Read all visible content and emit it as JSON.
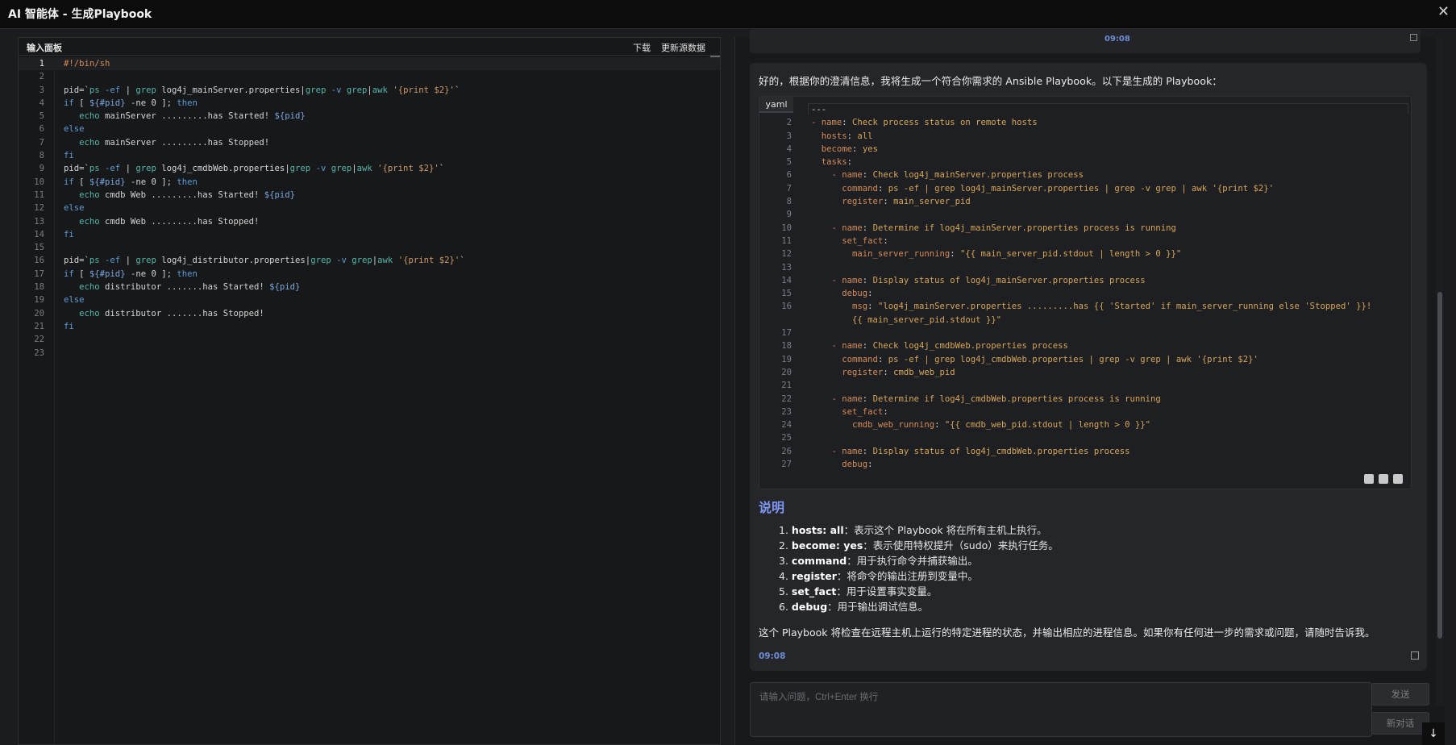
{
  "window": {
    "title": "AI 智能体 - 生成Playbook",
    "close": "✕"
  },
  "left_panel": {
    "title": "输入面板",
    "download": "下载",
    "update_source": "更新源数据",
    "lines": [
      {
        "n": "1",
        "t": [
          [
            "cm",
            "#!/bin/sh"
          ]
        ]
      },
      {
        "n": "2",
        "t": []
      },
      {
        "n": "3",
        "t": [
          [
            "tx",
            "pid=`"
          ],
          [
            "fn",
            "ps"
          ],
          [
            "tx",
            " "
          ],
          [
            "kw",
            "-ef"
          ],
          [
            "tx",
            " | "
          ],
          [
            "fn",
            "grep"
          ],
          [
            "tx",
            " log4j_mainServer.properties|"
          ],
          [
            "fn",
            "grep"
          ],
          [
            "tx",
            " "
          ],
          [
            "kw",
            "-v"
          ],
          [
            "tx",
            " "
          ],
          [
            "fn",
            "grep"
          ],
          [
            "tx",
            "|"
          ],
          [
            "fn",
            "awk"
          ],
          [
            "tx",
            " "
          ],
          [
            "st",
            "'{print $2}'"
          ],
          [
            "tx",
            "`"
          ]
        ]
      },
      {
        "n": "4",
        "t": [
          [
            "kw",
            "if"
          ],
          [
            "tx",
            " [ "
          ],
          [
            "vr",
            "${#pid}"
          ],
          [
            "tx",
            " -ne 0 ]; "
          ],
          [
            "kw",
            "then"
          ]
        ]
      },
      {
        "n": "5",
        "t": [
          [
            "tx",
            "   "
          ],
          [
            "fn",
            "echo"
          ],
          [
            "tx",
            " mainServer .........has Started! "
          ],
          [
            "vr",
            "${pid}"
          ]
        ]
      },
      {
        "n": "6",
        "t": [
          [
            "kw",
            "else"
          ]
        ]
      },
      {
        "n": "7",
        "t": [
          [
            "tx",
            "   "
          ],
          [
            "fn",
            "echo"
          ],
          [
            "tx",
            " mainServer .........has Stopped!"
          ]
        ]
      },
      {
        "n": "8",
        "t": [
          [
            "kw",
            "fi"
          ]
        ]
      },
      {
        "n": "9",
        "t": [
          [
            "tx",
            "pid=`"
          ],
          [
            "fn",
            "ps"
          ],
          [
            "tx",
            " "
          ],
          [
            "kw",
            "-ef"
          ],
          [
            "tx",
            " | "
          ],
          [
            "fn",
            "grep"
          ],
          [
            "tx",
            " log4j_cmdbWeb.properties|"
          ],
          [
            "fn",
            "grep"
          ],
          [
            "tx",
            " "
          ],
          [
            "kw",
            "-v"
          ],
          [
            "tx",
            " "
          ],
          [
            "fn",
            "grep"
          ],
          [
            "tx",
            "|"
          ],
          [
            "fn",
            "awk"
          ],
          [
            "tx",
            " "
          ],
          [
            "st",
            "'{print $2}'"
          ],
          [
            "tx",
            "`"
          ]
        ]
      },
      {
        "n": "10",
        "t": [
          [
            "kw",
            "if"
          ],
          [
            "tx",
            " [ "
          ],
          [
            "vr",
            "${#pid}"
          ],
          [
            "tx",
            " -ne 0 ]; "
          ],
          [
            "kw",
            "then"
          ]
        ]
      },
      {
        "n": "11",
        "t": [
          [
            "tx",
            "   "
          ],
          [
            "fn",
            "echo"
          ],
          [
            "tx",
            " cmdb Web .........has Started! "
          ],
          [
            "vr",
            "${pid}"
          ]
        ]
      },
      {
        "n": "12",
        "t": [
          [
            "kw",
            "else"
          ]
        ]
      },
      {
        "n": "13",
        "t": [
          [
            "tx",
            "   "
          ],
          [
            "fn",
            "echo"
          ],
          [
            "tx",
            " cmdb Web .........has Stopped!"
          ]
        ]
      },
      {
        "n": "14",
        "t": [
          [
            "kw",
            "fi"
          ]
        ]
      },
      {
        "n": "15",
        "t": []
      },
      {
        "n": "16",
        "t": [
          [
            "tx",
            "pid=`"
          ],
          [
            "fn",
            "ps"
          ],
          [
            "tx",
            " "
          ],
          [
            "kw",
            "-ef"
          ],
          [
            "tx",
            " | "
          ],
          [
            "fn",
            "grep"
          ],
          [
            "tx",
            " log4j_distributor.properties|"
          ],
          [
            "fn",
            "grep"
          ],
          [
            "tx",
            " "
          ],
          [
            "kw",
            "-v"
          ],
          [
            "tx",
            " "
          ],
          [
            "fn",
            "grep"
          ],
          [
            "tx",
            "|"
          ],
          [
            "fn",
            "awk"
          ],
          [
            "tx",
            " "
          ],
          [
            "st",
            "'{print $2}'"
          ],
          [
            "tx",
            "`"
          ]
        ]
      },
      {
        "n": "17",
        "t": [
          [
            "kw",
            "if"
          ],
          [
            "tx",
            " [ "
          ],
          [
            "vr",
            "${#pid}"
          ],
          [
            "tx",
            " -ne 0 ]; "
          ],
          [
            "kw",
            "then"
          ]
        ]
      },
      {
        "n": "18",
        "t": [
          [
            "tx",
            "   "
          ],
          [
            "fn",
            "echo"
          ],
          [
            "tx",
            " distributor .......has Started! "
          ],
          [
            "vr",
            "${pid}"
          ]
        ]
      },
      {
        "n": "19",
        "t": [
          [
            "kw",
            "else"
          ]
        ]
      },
      {
        "n": "20",
        "t": [
          [
            "tx",
            "   "
          ],
          [
            "fn",
            "echo"
          ],
          [
            "tx",
            " distributor .......has Stopped!"
          ]
        ]
      },
      {
        "n": "21",
        "t": [
          [
            "kw",
            "fi"
          ]
        ]
      },
      {
        "n": "22",
        "t": []
      },
      {
        "n": "23",
        "t": []
      }
    ]
  },
  "chat": {
    "prev_time": "09:08",
    "intro": "好的，根据你的澄清信息，我将生成一个符合你需求的 Ansible Playbook。以下是生成的 Playbook：",
    "code_lang": "yaml",
    "yaml_lines": [
      {
        "n": "",
        "t": [
          [
            "tx",
            "---"
          ]
        ]
      },
      {
        "n": "2",
        "t": [
          [
            "bul",
            "- "
          ],
          [
            "key",
            "name"
          ],
          [
            "tx",
            ": "
          ],
          [
            "val",
            "Check process status on remote hosts"
          ]
        ]
      },
      {
        "n": "3",
        "t": [
          [
            "tx",
            "  "
          ],
          [
            "key",
            "hosts"
          ],
          [
            "tx",
            ": "
          ],
          [
            "val",
            "all"
          ]
        ]
      },
      {
        "n": "4",
        "t": [
          [
            "tx",
            "  "
          ],
          [
            "key",
            "become"
          ],
          [
            "tx",
            ": "
          ],
          [
            "val",
            "yes"
          ]
        ]
      },
      {
        "n": "5",
        "t": [
          [
            "tx",
            "  "
          ],
          [
            "key",
            "tasks"
          ],
          [
            "tx",
            ":"
          ]
        ]
      },
      {
        "n": "6",
        "t": [
          [
            "tx",
            "    "
          ],
          [
            "bul",
            "- "
          ],
          [
            "key",
            "name"
          ],
          [
            "tx",
            ": "
          ],
          [
            "val",
            "Check log4j_mainServer.properties process"
          ]
        ]
      },
      {
        "n": "7",
        "t": [
          [
            "tx",
            "      "
          ],
          [
            "key",
            "command"
          ],
          [
            "tx",
            ": "
          ],
          [
            "val",
            "ps -ef | grep log4j_mainServer.properties | grep -v grep | awk '{print $2}'"
          ]
        ]
      },
      {
        "n": "8",
        "t": [
          [
            "tx",
            "      "
          ],
          [
            "key",
            "register"
          ],
          [
            "tx",
            ": "
          ],
          [
            "val",
            "main_server_pid"
          ]
        ]
      },
      {
        "n": "9",
        "t": []
      },
      {
        "n": "10",
        "t": [
          [
            "tx",
            "    "
          ],
          [
            "bul",
            "- "
          ],
          [
            "key",
            "name"
          ],
          [
            "tx",
            ": "
          ],
          [
            "val",
            "Determine if log4j_mainServer.properties process is running"
          ]
        ]
      },
      {
        "n": "11",
        "t": [
          [
            "tx",
            "      "
          ],
          [
            "key",
            "set_fact"
          ],
          [
            "tx",
            ":"
          ]
        ]
      },
      {
        "n": "12",
        "t": [
          [
            "tx",
            "        "
          ],
          [
            "key",
            "main_server_running"
          ],
          [
            "tx",
            ": "
          ],
          [
            "val",
            "\"{{ main_server_pid.stdout | length > 0 }}\""
          ]
        ]
      },
      {
        "n": "13",
        "t": []
      },
      {
        "n": "14",
        "t": [
          [
            "tx",
            "    "
          ],
          [
            "bul",
            "- "
          ],
          [
            "key",
            "name"
          ],
          [
            "tx",
            ": "
          ],
          [
            "val",
            "Display status of log4j_mainServer.properties process"
          ]
        ]
      },
      {
        "n": "15",
        "t": [
          [
            "tx",
            "      "
          ],
          [
            "key",
            "debug"
          ],
          [
            "tx",
            ":"
          ]
        ]
      },
      {
        "n": "16",
        "t": [
          [
            "tx",
            "        "
          ],
          [
            "key",
            "msg"
          ],
          [
            "tx",
            ": "
          ],
          [
            "val",
            "\"log4j_mainServer.properties .........has {{ 'Started' if main_server_running else 'Stopped' }}!"
          ]
        ]
      },
      {
        "n": "",
        "t": [
          [
            "tx",
            "        "
          ],
          [
            "val",
            "{{ main_server_pid.stdout }}\""
          ]
        ]
      },
      {
        "n": "17",
        "t": []
      },
      {
        "n": "18",
        "t": [
          [
            "tx",
            "    "
          ],
          [
            "bul",
            "- "
          ],
          [
            "key",
            "name"
          ],
          [
            "tx",
            ": "
          ],
          [
            "val",
            "Check log4j_cmdbWeb.properties process"
          ]
        ]
      },
      {
        "n": "19",
        "t": [
          [
            "tx",
            "      "
          ],
          [
            "key",
            "command"
          ],
          [
            "tx",
            ": "
          ],
          [
            "val",
            "ps -ef | grep log4j_cmdbWeb.properties | grep -v grep | awk '{print $2}'"
          ]
        ]
      },
      {
        "n": "20",
        "t": [
          [
            "tx",
            "      "
          ],
          [
            "key",
            "register"
          ],
          [
            "tx",
            ": "
          ],
          [
            "val",
            "cmdb_web_pid"
          ]
        ]
      },
      {
        "n": "21",
        "t": []
      },
      {
        "n": "22",
        "t": [
          [
            "tx",
            "    "
          ],
          [
            "bul",
            "- "
          ],
          [
            "key",
            "name"
          ],
          [
            "tx",
            ": "
          ],
          [
            "val",
            "Determine if log4j_cmdbWeb.properties process is running"
          ]
        ]
      },
      {
        "n": "23",
        "t": [
          [
            "tx",
            "      "
          ],
          [
            "key",
            "set_fact"
          ],
          [
            "tx",
            ":"
          ]
        ]
      },
      {
        "n": "24",
        "t": [
          [
            "tx",
            "        "
          ],
          [
            "key",
            "cmdb_web_running"
          ],
          [
            "tx",
            ": "
          ],
          [
            "val",
            "\"{{ cmdb_web_pid.stdout | length > 0 }}\""
          ]
        ]
      },
      {
        "n": "25",
        "t": []
      },
      {
        "n": "26",
        "t": [
          [
            "tx",
            "    "
          ],
          [
            "bul",
            "- "
          ],
          [
            "key",
            "name"
          ],
          [
            "tx",
            ": "
          ],
          [
            "val",
            "Display status of log4j_cmdbWeb.properties process"
          ]
        ]
      },
      {
        "n": "27",
        "t": [
          [
            "tx",
            "      "
          ],
          [
            "key",
            "debug"
          ],
          [
            "tx",
            ":"
          ]
        ]
      }
    ],
    "section_title": "说明",
    "items": [
      {
        "num": "1.",
        "key": "hosts: all",
        "desc": "：表示这个 Playbook 将在所有主机上执行。"
      },
      {
        "num": "2.",
        "key": "become: yes",
        "desc": "：表示使用特权提升（sudo）来执行任务。"
      },
      {
        "num": "3.",
        "key": "command",
        "desc": "：用于执行命令并捕获输出。"
      },
      {
        "num": "4.",
        "key": "register",
        "desc": "：将命令的输出注册到变量中。"
      },
      {
        "num": "5.",
        "key": "set_fact",
        "desc": "：用于设置事实变量。"
      },
      {
        "num": "6.",
        "key": "debug",
        "desc": "：用于输出调试信息。"
      }
    ],
    "summary": "这个 Playbook 将检查在远程主机上运行的特定进程的状态，并输出相应的进程信息。如果你有任何进一步的需求或问题，请随时告诉我。",
    "time": "09:08"
  },
  "input": {
    "placeholder": "请输入问题，Ctrl+Enter 换行",
    "value": "",
    "send": "发送",
    "new_chat": "新对话",
    "scroll_down": "↓"
  },
  "icons": {
    "close": "close-icon",
    "copy": "copy-icon",
    "edit": "edit-icon",
    "check": "check-icon",
    "expand": "expand-icon",
    "arrow_down": "arrow-down-icon"
  }
}
